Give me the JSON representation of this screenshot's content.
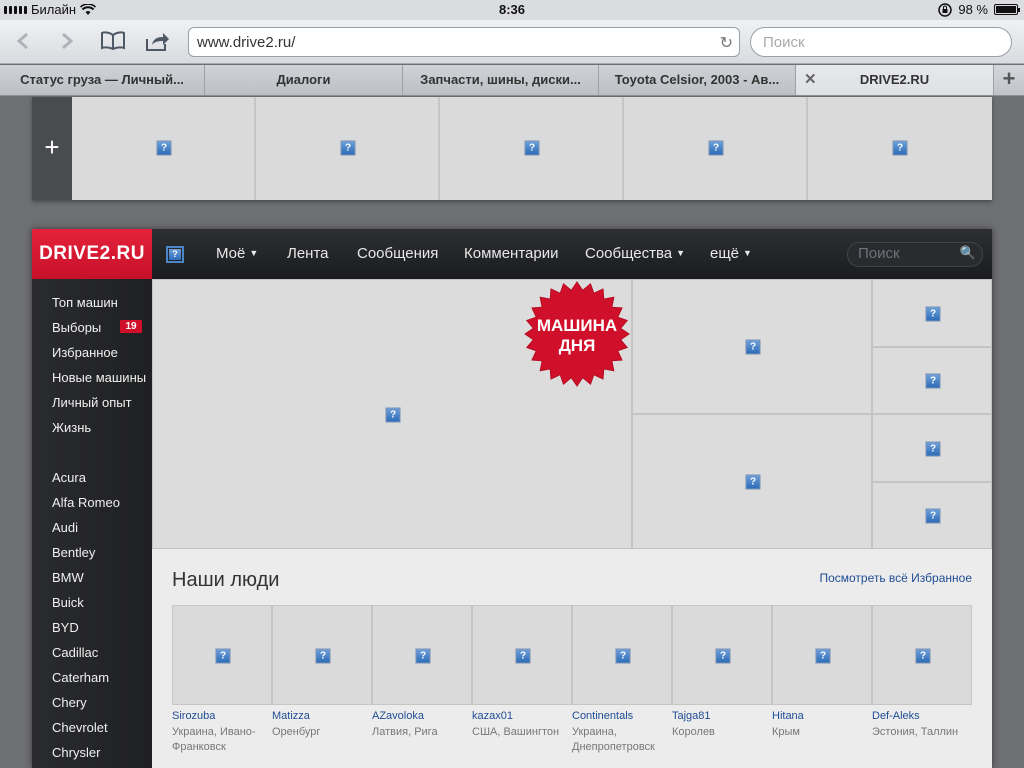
{
  "status_bar": {
    "carrier": "Билайн",
    "time": "8:36",
    "battery": "98 %"
  },
  "browser": {
    "url": "www.drive2.ru/",
    "search_placeholder": "Поиск",
    "tabs": [
      {
        "label": "Статус груза — Личный..."
      },
      {
        "label": "Диалоги"
      },
      {
        "label": "Запчасти, шины, диски..."
      },
      {
        "label": "Toyota Celsior, 2003 - Ав..."
      },
      {
        "label": "DRIVE2.RU"
      }
    ],
    "new_tab": "+"
  },
  "banner": {
    "add": "+"
  },
  "site": {
    "logo": "DRIVE2.RU",
    "nav": [
      {
        "label": "Моё",
        "dropdown": true
      },
      {
        "label": "Лента"
      },
      {
        "label": "Сообщения"
      },
      {
        "label": "Комментарии"
      },
      {
        "label": "Сообщества",
        "dropdown": true
      },
      {
        "label": "ещё",
        "dropdown": true
      }
    ],
    "search_placeholder": "Поиск",
    "sidebar": {
      "sections": [
        {
          "label": "Топ машин"
        },
        {
          "label": "Выборы",
          "badge": "19"
        },
        {
          "label": "Избранное"
        },
        {
          "label": "Новые машины"
        },
        {
          "label": "Личный опыт"
        },
        {
          "label": "Жизнь"
        }
      ],
      "brands": [
        "Acura",
        "Alfa Romeo",
        "Audi",
        "Bentley",
        "BMW",
        "Buick",
        "BYD",
        "Cadillac",
        "Caterham",
        "Chery",
        "Chevrolet",
        "Chrysler"
      ]
    },
    "featured_badge": {
      "line1": "МАШИНА",
      "line2": "ДНЯ"
    },
    "people": {
      "title": "Наши люди",
      "link": "Посмотреть всё Избранное",
      "items": [
        {
          "name": "Sirozuba",
          "location": "Украина, Ивано-Франковск"
        },
        {
          "name": "Matizza",
          "location": "Оренбург"
        },
        {
          "name": "AZavoloka",
          "location": "Латвия, Рига"
        },
        {
          "name": "kazax01",
          "location": "США, Вашингтон"
        },
        {
          "name": "Continentals",
          "location": "Украина, Днепропетровск"
        },
        {
          "name": "Tajga81",
          "location": "Королев"
        },
        {
          "name": "Hitana",
          "location": "Крым"
        },
        {
          "name": "Def-Aleks",
          "location": "Эстония, Таллин"
        }
      ]
    }
  },
  "colors": {
    "brand_red": "#d0102a",
    "header_dark": "#1b1c1e",
    "link_blue": "#1f4d94"
  }
}
